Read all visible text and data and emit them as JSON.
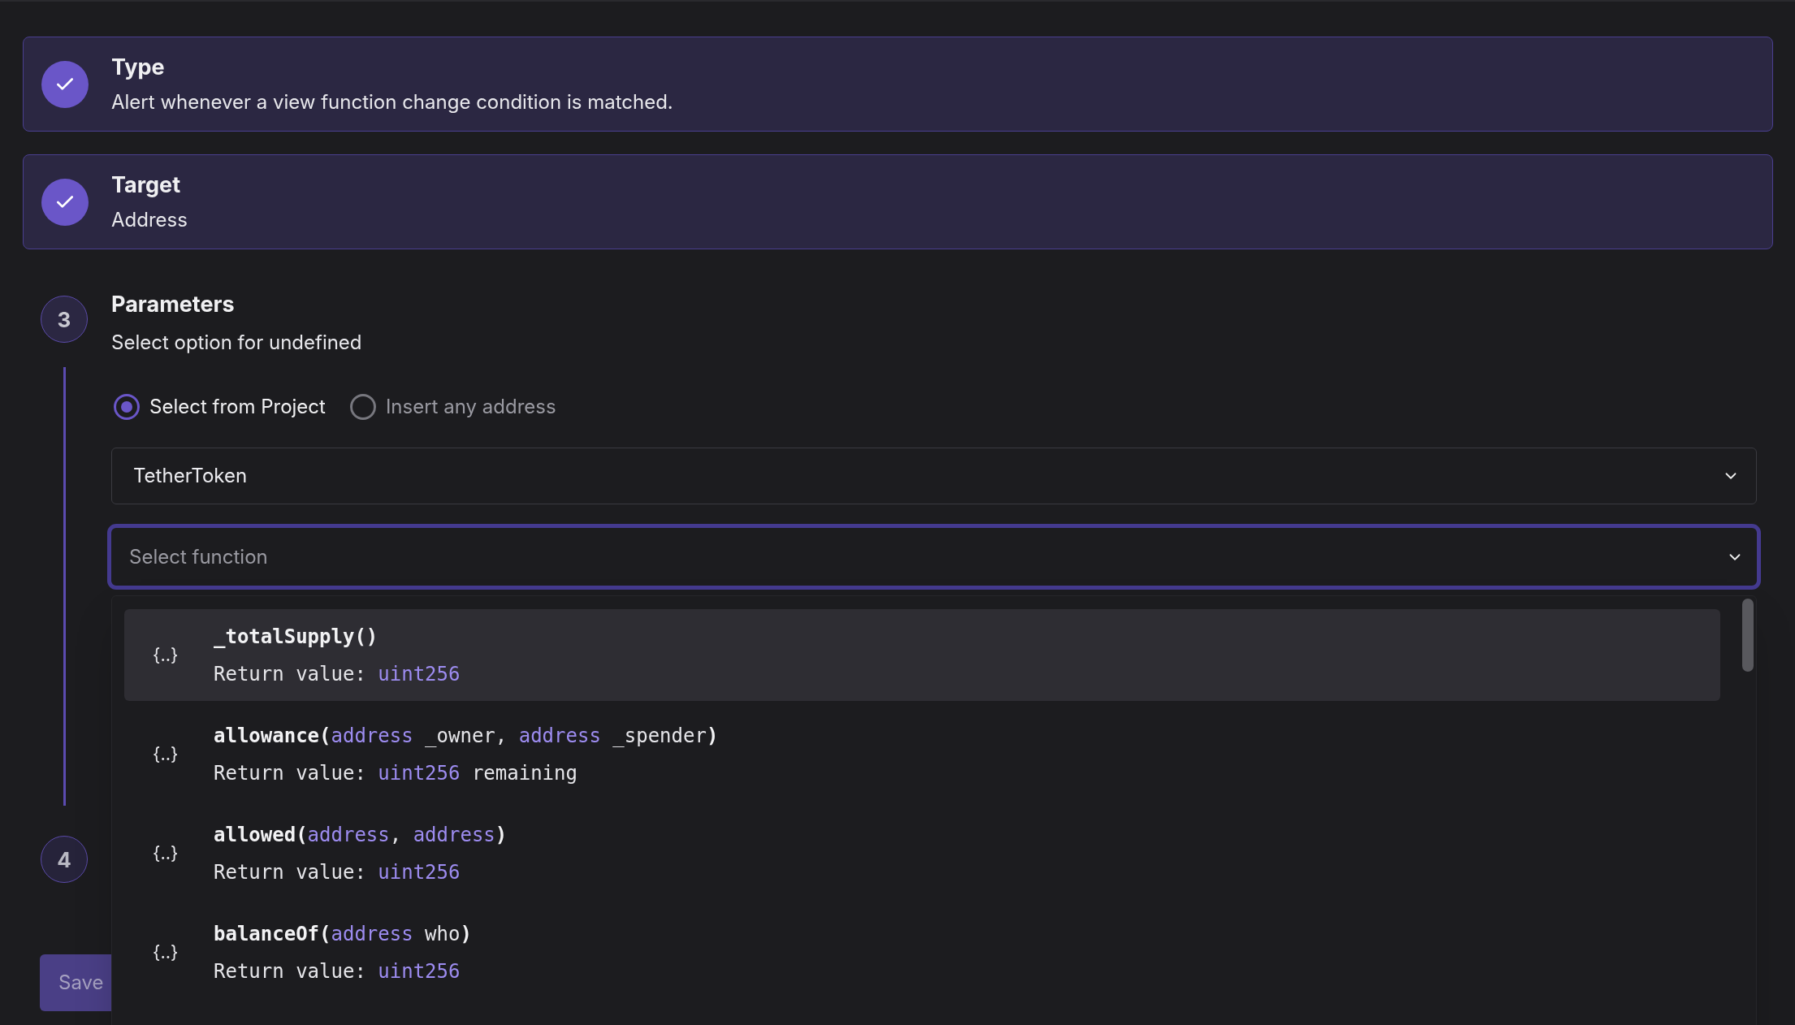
{
  "steps": [
    {
      "completed": true,
      "title": "Type",
      "description": "Alert whenever a view function change condition is matched."
    },
    {
      "completed": true,
      "title": "Target",
      "description": "Address"
    },
    {
      "completed": false,
      "number": "3",
      "title": "Parameters",
      "description": "Select option for undefined"
    },
    {
      "completed": false,
      "number": "4"
    }
  ],
  "source_options": [
    {
      "label": "Select from Project",
      "selected": true
    },
    {
      "label": "Insert any address",
      "selected": false
    }
  ],
  "contract_select": {
    "value": "TetherToken"
  },
  "function_select": {
    "placeholder": "Select function",
    "focused": true
  },
  "function_list": [
    {
      "icon": "{..}",
      "highlighted": true,
      "signature": [
        {
          "kind": "name",
          "text": "_totalSupply()"
        }
      ],
      "returns": [
        {
          "kind": "arg",
          "text": "Return value: "
        },
        {
          "kind": "type",
          "text": "uint256"
        }
      ]
    },
    {
      "icon": "{..}",
      "highlighted": false,
      "signature": [
        {
          "kind": "name",
          "text": "allowance("
        },
        {
          "kind": "type",
          "text": "address"
        },
        {
          "kind": "arg",
          "text": " _owner, "
        },
        {
          "kind": "type",
          "text": "address"
        },
        {
          "kind": "arg",
          "text": " _spender"
        },
        {
          "kind": "name",
          "text": ")"
        }
      ],
      "returns": [
        {
          "kind": "arg",
          "text": "Return value: "
        },
        {
          "kind": "type",
          "text": "uint256"
        },
        {
          "kind": "arg",
          "text": " remaining"
        }
      ]
    },
    {
      "icon": "{..}",
      "highlighted": false,
      "signature": [
        {
          "kind": "name",
          "text": "allowed("
        },
        {
          "kind": "type",
          "text": "address"
        },
        {
          "kind": "arg",
          "text": ", "
        },
        {
          "kind": "type",
          "text": "address"
        },
        {
          "kind": "name",
          "text": ")"
        }
      ],
      "returns": [
        {
          "kind": "arg",
          "text": "Return value: "
        },
        {
          "kind": "type",
          "text": "uint256"
        }
      ]
    },
    {
      "icon": "{..}",
      "highlighted": false,
      "signature": [
        {
          "kind": "name",
          "text": "balanceOf("
        },
        {
          "kind": "type",
          "text": "address"
        },
        {
          "kind": "arg",
          "text": " who"
        },
        {
          "kind": "name",
          "text": ")"
        }
      ],
      "returns": [
        {
          "kind": "arg",
          "text": "Return value: "
        },
        {
          "kind": "type",
          "text": "uint256"
        }
      ]
    }
  ],
  "save_button": {
    "label": "Save",
    "disabled": true
  }
}
